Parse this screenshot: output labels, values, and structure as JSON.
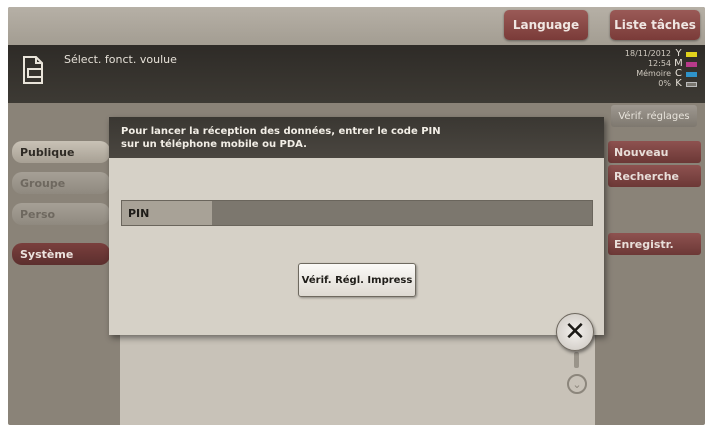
{
  "top_buttons": {
    "language": "Language",
    "job_list": "Liste tâches"
  },
  "header": {
    "title": "Sélect. fonct. voulue",
    "datetime": "18/11/2012",
    "time": "12:54",
    "memory_label": "Mémoire",
    "memory_value": "0%"
  },
  "toner": [
    {
      "letter": "Y",
      "color": "#e2d21c"
    },
    {
      "letter": "M",
      "color": "#b83a8a"
    },
    {
      "letter": "C",
      "color": "#2f93c9"
    },
    {
      "letter": "K",
      "color": "#7a7770"
    }
  ],
  "right_panel": {
    "verify_settings": "Vérif. réglages",
    "new": "Nouveau",
    "search": "Recherche",
    "register": "Enregistr."
  },
  "left_tabs": [
    {
      "label": "Publique",
      "state": "active"
    },
    {
      "label": "Groupe",
      "state": "dim"
    },
    {
      "label": "Perso",
      "state": "dim"
    },
    {
      "label": "Système",
      "state": "normal"
    }
  ],
  "dialog": {
    "message": "Pour lancer la réception des données, entrer le code PIN\nsur un téléphone mobile ou PDA.",
    "pin_label": "PIN",
    "pin_value": "",
    "verify_button": "Vérif. Régl. Impress",
    "close_symbol": "✕"
  },
  "scroll_symbol": "⌄"
}
